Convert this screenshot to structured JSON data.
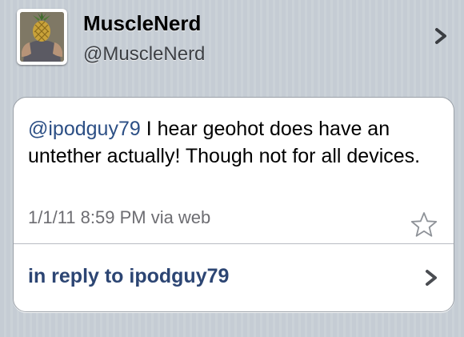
{
  "profile": {
    "display_name": "MuscleNerd",
    "screen_name": "@MuscleNerd",
    "avatar_icon": "profile-photo"
  },
  "tweet": {
    "mention": "@ipodguy79",
    "text": " I hear geohot does have an untether actually!  Though not for all devices.",
    "meta": "1/1/11 8:59 PM via web",
    "favorite_icon": "star-outline-icon"
  },
  "reply": {
    "label": "in reply to ipodguy79",
    "chevron_icon": "chevron-right-icon"
  },
  "colors": {
    "mention": "#2c4f85",
    "reply_link": "#2c4573",
    "meta_text": "#6d6d72",
    "background": "#c5ccd4"
  }
}
